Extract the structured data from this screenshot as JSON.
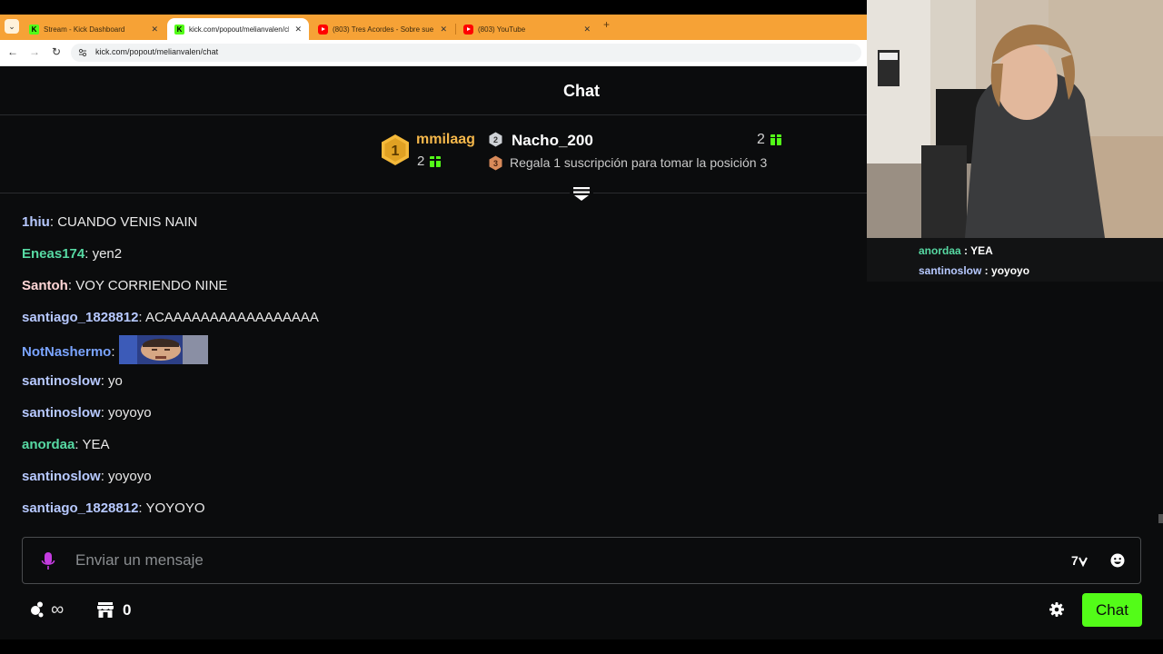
{
  "browser": {
    "tabs": [
      {
        "title": "Stream - Kick Dashboard",
        "favicon": "kick-icon",
        "active": false
      },
      {
        "title": "kick.com/popout/melianvalen/chat",
        "favicon": "kick-icon",
        "active": true
      },
      {
        "title": "(803) Tres Acordes - Sobre sue",
        "favicon": "youtube-icon",
        "active": false
      },
      {
        "title": "(803) YouTube",
        "favicon": "youtube-icon",
        "active": false
      }
    ],
    "url": "kick.com/popout/melianvalen/chat"
  },
  "chat": {
    "title": "Chat",
    "leaderboard": {
      "first": {
        "rank": "1",
        "user": "mmilaag",
        "count": "2"
      },
      "second": {
        "rank": "2",
        "user": "Nacho_200",
        "count": "2"
      },
      "third": {
        "rank": "3",
        "text": "Regala 1 suscripción para tomar la posición 3"
      }
    },
    "messages": [
      {
        "user": "1hiu",
        "color": "#b7c9ff",
        "text": "CUANDO VENIS NAIN"
      },
      {
        "user": "Eneas174",
        "color": "#57d9a3",
        "text": "yen2"
      },
      {
        "user": "Santoh",
        "color": "#ffd6d6",
        "text": "VOY CORRIENDO NINE"
      },
      {
        "user": "santiago_1828812",
        "color": "#b7c9ff",
        "text": "ACAAAAAAAAAAAAAAAAA"
      },
      {
        "user": "NotNashermo",
        "color": "#7aa4ff",
        "text": "",
        "emote": true
      },
      {
        "user": "santinoslow",
        "color": "#b7c9ff",
        "text": "yo"
      },
      {
        "user": "santinoslow",
        "color": "#b7c9ff",
        "text": "yoyoyo"
      },
      {
        "user": "anordaa",
        "color": "#57d9a3",
        "text": "YEA"
      },
      {
        "user": "santinoslow",
        "color": "#b7c9ff",
        "text": "yoyoyo"
      },
      {
        "user": "santiago_1828812",
        "color": "#b7c9ff",
        "text": "YOYOYO"
      }
    ],
    "input_placeholder": "Enviar un mensaje",
    "viewers": "∞",
    "points": "0",
    "send_label": "Chat"
  },
  "overlay": {
    "messages": [
      {
        "user": "anordaa",
        "color": "#57d9a3",
        "text": "YEA"
      },
      {
        "user": "santinoslow",
        "color": "#b7c9ff",
        "text": "yoyoyo"
      }
    ]
  },
  "colors": {
    "accent": "#53fc18",
    "gold": "#f6b84b",
    "background": "#0b0c0d"
  }
}
